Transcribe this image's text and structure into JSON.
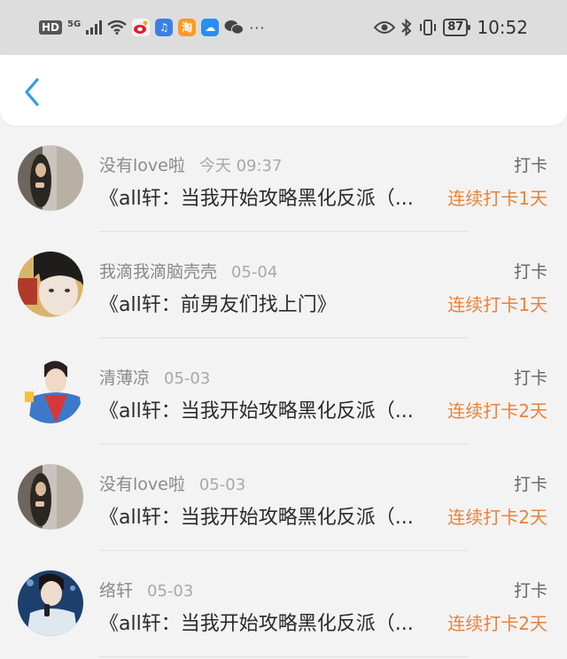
{
  "status_bar": {
    "hd": "HD",
    "network": "5G",
    "battery": "87",
    "time": "10:52",
    "more": "···",
    "icons": [
      "signal-icon",
      "wifi-icon",
      "weibo-icon",
      "music-icon",
      "taobao-icon",
      "cloud-icon",
      "wechat-icon",
      "eye-icon",
      "bluetooth-icon",
      "vibrate-icon"
    ]
  },
  "nav": {
    "back_icon": "chevron-left-icon"
  },
  "colors": {
    "accent_blue": "#2f9bec",
    "streak_orange": "#e8823a"
  },
  "items": [
    {
      "user": "没有love啦",
      "time": "今天 09:37",
      "label": "打卡",
      "title": "《all轩：当我开始攻略黑化反派（...",
      "streak": "连续打卡1天",
      "avatar": "avatar-girl-photo"
    },
    {
      "user": "我滴我滴脑壳壳",
      "time": "05-04",
      "label": "打卡",
      "title": "《all轩：前男友们找上门》",
      "streak": "连续打卡1天",
      "avatar": "avatar-boy-closeup"
    },
    {
      "user": "清薄凉",
      "time": "05-03",
      "label": "打卡",
      "title": "《all轩：当我开始攻略黑化反派（...",
      "streak": "连续打卡2天",
      "avatar": "avatar-boy-jacket"
    },
    {
      "user": "没有love啦",
      "time": "05-03",
      "label": "打卡",
      "title": "《all轩：当我开始攻略黑化反派（...",
      "streak": "连续打卡2天",
      "avatar": "avatar-girl-photo"
    },
    {
      "user": "络轩",
      "time": "05-03",
      "label": "打卡",
      "title": "《all轩：当我开始攻略黑化反派（...",
      "streak": "连续打卡2天",
      "avatar": "avatar-singer"
    }
  ]
}
